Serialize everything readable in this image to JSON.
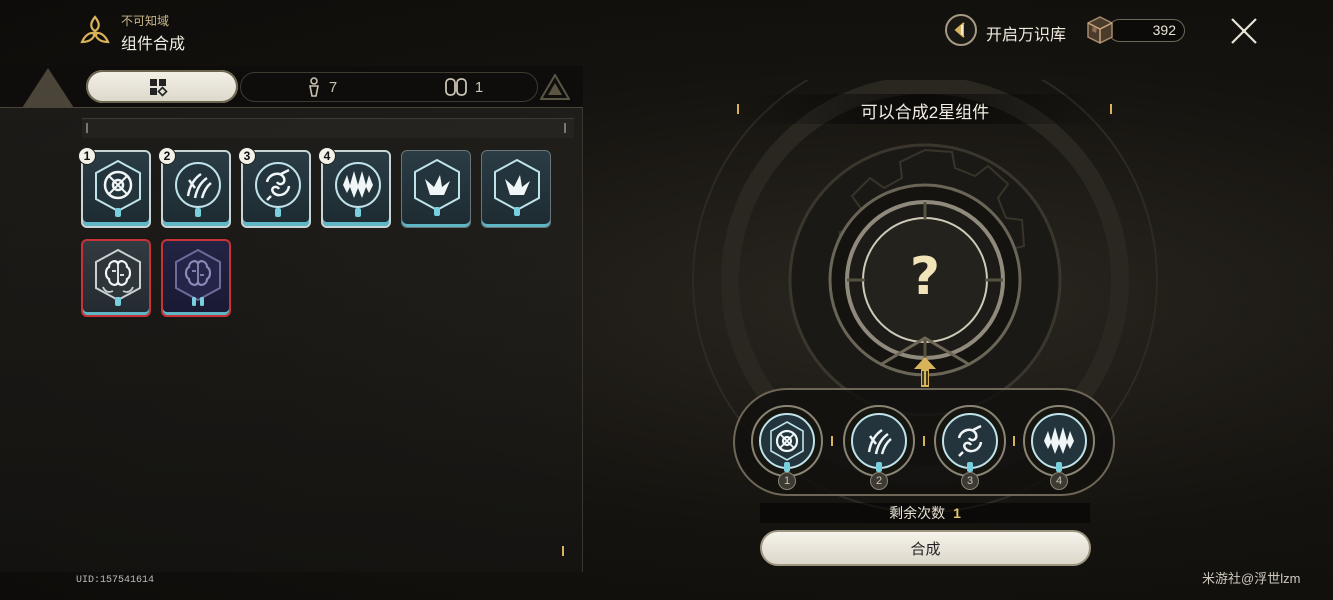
{
  "header": {
    "subtitle": "不可知域",
    "title": "组件合成",
    "logo_icon": "triad-flower-icon"
  },
  "tabs": [
    {
      "icon": "grid-diamond-icon",
      "label": "",
      "active": true
    },
    {
      "icon": "figure-icon",
      "label": "7",
      "active": false
    },
    {
      "icon": "double-ring-icon",
      "label": "1",
      "active": false
    }
  ],
  "inventory": {
    "row1": [
      {
        "badge": "1",
        "icon": "gear-cross-icon",
        "selected": true
      },
      {
        "badge": "2",
        "icon": "claw-icon",
        "selected": true
      },
      {
        "badge": "3",
        "icon": "swirl-icon",
        "selected": true
      },
      {
        "badge": "4",
        "icon": "spike-icon",
        "selected": true
      },
      {
        "badge": "",
        "icon": "shard-icon",
        "selected": false
      },
      {
        "badge": "",
        "icon": "shard-icon",
        "selected": false
      }
    ],
    "row2": [
      {
        "badge": "",
        "icon": "brain-icon",
        "rarity": "red"
      },
      {
        "badge": "",
        "icon": "brain-icon",
        "rarity": "red-dark"
      }
    ]
  },
  "uid": "UID:157541614",
  "top_right": {
    "vault_label": "开启万识库",
    "currency_value": "392",
    "currency_icon": "cube-ore-icon"
  },
  "synthesis": {
    "title": "可以合成2星组件",
    "result_placeholder": "?",
    "slots": [
      {
        "num": "1",
        "icon": "gear-cross-icon"
      },
      {
        "num": "2",
        "icon": "claw-icon"
      },
      {
        "num": "3",
        "icon": "swirl-icon"
      },
      {
        "num": "4",
        "icon": "spike-icon"
      }
    ],
    "remaining_label": "剩余次数",
    "remaining_value": "1",
    "button_label": "合成"
  },
  "watermark": "米游社@浮世lzm",
  "colors": {
    "accent_gold": "#d9b35a",
    "card_glow": "#5fb7c6",
    "rare_red": "#c73336",
    "button_bg": "#f2efe6"
  }
}
